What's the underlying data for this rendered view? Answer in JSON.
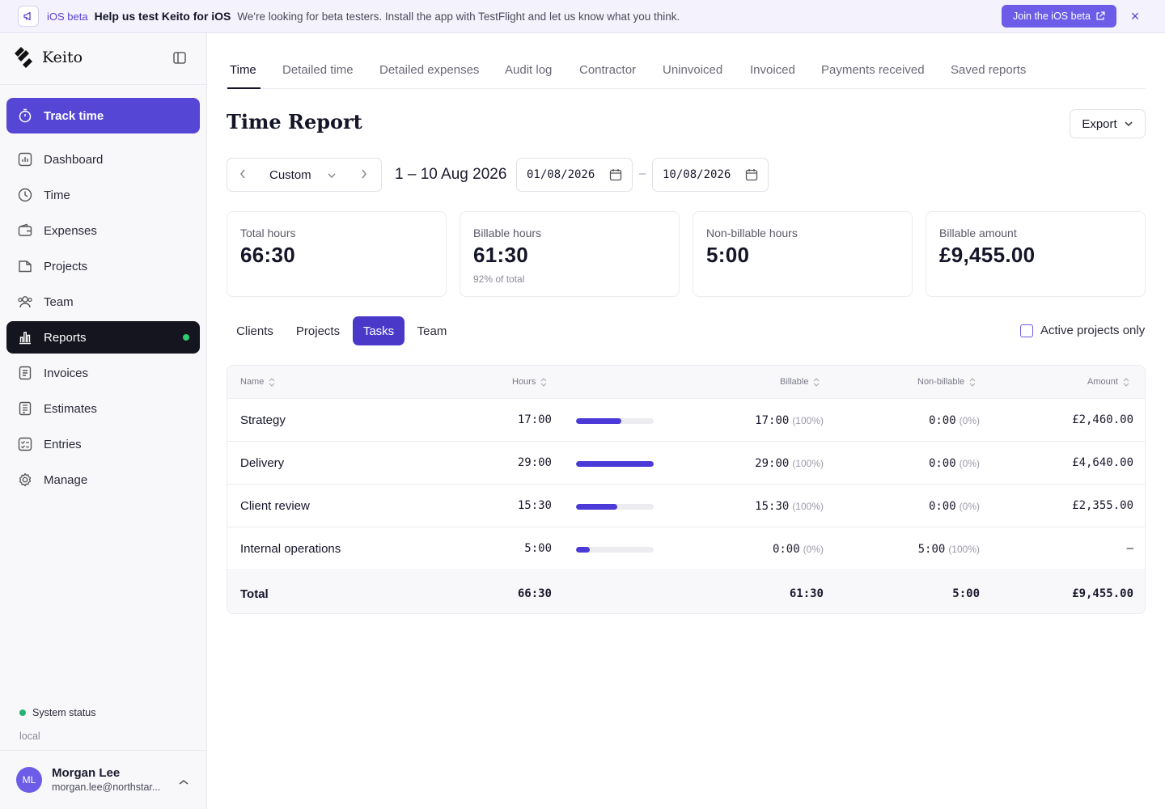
{
  "banner": {
    "tag": "iOS beta",
    "title": "Help us test Keito for iOS",
    "message": "We're looking for beta testers. Install the app with TestFlight and let us know what you think.",
    "button": "Join the iOS beta"
  },
  "brand": {
    "name": "Keito"
  },
  "sidebar": {
    "track": "Track time",
    "items": [
      {
        "label": "Dashboard"
      },
      {
        "label": "Time"
      },
      {
        "label": "Expenses"
      },
      {
        "label": "Projects"
      },
      {
        "label": "Team"
      },
      {
        "label": "Reports"
      },
      {
        "label": "Invoices"
      },
      {
        "label": "Estimates"
      },
      {
        "label": "Entries"
      },
      {
        "label": "Manage"
      }
    ],
    "status": "System status",
    "env": "local",
    "user": {
      "initials": "ML",
      "name": "Morgan Lee",
      "email": "morgan.lee@northstar..."
    }
  },
  "tabs": [
    "Time",
    "Detailed time",
    "Detailed expenses",
    "Audit log",
    "Contractor",
    "Uninvoiced",
    "Invoiced",
    "Payments received",
    "Saved reports"
  ],
  "page": {
    "title": "Time Report",
    "export": "Export",
    "range_label": "Custom",
    "range_text": "1 – 10 Aug 2026",
    "date_from": "01/08/2026",
    "date_to": "10/08/2026",
    "date_sep": "–"
  },
  "cards": [
    {
      "label": "Total hours",
      "value": "66:30",
      "sub": ""
    },
    {
      "label": "Billable hours",
      "value": "61:30",
      "sub": "92% of total"
    },
    {
      "label": "Non-billable hours",
      "value": "5:00",
      "sub": ""
    },
    {
      "label": "Billable amount",
      "value": "£9,455.00",
      "sub": ""
    }
  ],
  "segments": [
    "Clients",
    "Projects",
    "Tasks",
    "Team"
  ],
  "active_only": "Active projects only",
  "table": {
    "headers": {
      "name": "Name",
      "hours": "Hours",
      "billable": "Billable",
      "nonbillable": "Non-billable",
      "amount": "Amount"
    },
    "rows": [
      {
        "name": "Strategy",
        "hours": "17:00",
        "share": 0.586,
        "billable": "17:00",
        "billable_pct": "(100%)",
        "nonbillable": "0:00",
        "nonbillable_pct": "(0%)",
        "amount": "£2,460.00"
      },
      {
        "name": "Delivery",
        "hours": "29:00",
        "share": 1.0,
        "billable": "29:00",
        "billable_pct": "(100%)",
        "nonbillable": "0:00",
        "nonbillable_pct": "(0%)",
        "amount": "£4,640.00"
      },
      {
        "name": "Client review",
        "hours": "15:30",
        "share": 0.534,
        "billable": "15:30",
        "billable_pct": "(100%)",
        "nonbillable": "0:00",
        "nonbillable_pct": "(0%)",
        "amount": "£2,355.00"
      },
      {
        "name": "Internal operations",
        "hours": "5:00",
        "share": 0.172,
        "billable": "0:00",
        "billable_pct": "(0%)",
        "nonbillable": "5:00",
        "nonbillable_pct": "(100%)",
        "amount": "–"
      }
    ],
    "total": {
      "name": "Total",
      "hours": "66:30",
      "billable": "61:30",
      "nonbillable": "5:00",
      "amount": "£9,455.00"
    }
  },
  "colors": {
    "accent": "#5646d6",
    "active_nav": "#15151f",
    "bar": "#4b3ad8"
  }
}
